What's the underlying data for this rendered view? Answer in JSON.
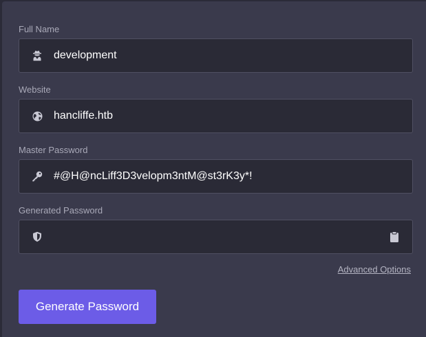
{
  "form": {
    "full_name": {
      "label": "Full Name",
      "value": "development",
      "icon": "user-secret-icon"
    },
    "website": {
      "label": "Website",
      "value": "hancliffe.htb",
      "icon": "globe-icon"
    },
    "master_password": {
      "label": "Master Password",
      "value": "#@H@ncLiff3D3velopm3ntM@st3rK3y*!",
      "icon": "key-icon"
    },
    "generated_password": {
      "label": "Generated Password",
      "value": "",
      "icon": "shield-icon",
      "copy_icon": "clipboard-icon"
    },
    "advanced_options_label": "Advanced Options",
    "generate_button_label": "Generate Password"
  },
  "colors": {
    "background": "#3a3a4c",
    "field_background": "#2a2a36",
    "accent": "#6c5ce7"
  }
}
